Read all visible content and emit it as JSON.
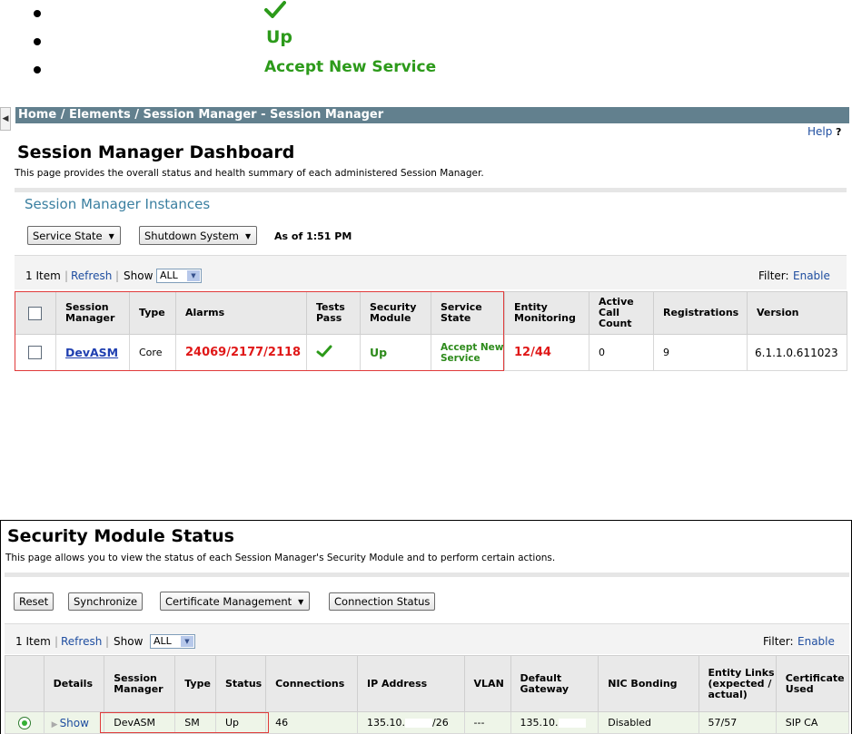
{
  "legend": {
    "items": [
      {
        "icon": "checkmark-icon",
        "text": ""
      },
      {
        "icon": "",
        "text": "Up"
      },
      {
        "icon": "",
        "text": "Accept New Service"
      }
    ]
  },
  "dashboard": {
    "breadcrumb": "Home / Elements / Session Manager - Session Manager",
    "help_label": "Help",
    "help_mark": "?",
    "title": "Session Manager Dashboard",
    "description": "This page provides the overall status and health summary of each administered Session Manager.",
    "section_title": "Session Manager Instances",
    "service_state_button": "Service State",
    "shutdown_button": "Shutdown System",
    "as_of": "As of 1:51 PM",
    "toolbar": {
      "item_count": "1 Item",
      "separator": "|",
      "refresh": "Refresh",
      "show_label": "Show",
      "show_value": "ALL",
      "filter_label": "Filter:",
      "filter_link": "Enable"
    },
    "columns": [
      "",
      "Session Manager",
      "Type",
      "Alarms",
      "Tests Pass",
      "Security Module",
      "Service State",
      "Entity Monitoring",
      "Active Call Count",
      "Registrations",
      "Version"
    ],
    "row": {
      "session_manager": "DevASM",
      "type": "Core",
      "alarms": "24069/2177/2118",
      "tests_pass_icon": "checkmark-icon",
      "security_module": "Up",
      "service_state": "Accept New Service",
      "entity_monitoring": "12/44",
      "active_call_count": "0",
      "registrations": "9",
      "version": "6.1.1.0.611023"
    },
    "colors": {
      "accent": "#3a7fa0",
      "breadcrumb_bg": "#62808e",
      "alarm": "#e01818",
      "ok": "#2c8a1a",
      "highlight": "#e03a3a"
    }
  },
  "security": {
    "title": "Security Module Status",
    "description": "This page allows you to view the status of each Session Manager's Security Module and to perform certain actions.",
    "buttons": {
      "reset": "Reset",
      "synchronize": "Synchronize",
      "certificate_management": "Certificate Management",
      "connection_status": "Connection Status"
    },
    "toolbar": {
      "item_count": "1 Item",
      "separator": "|",
      "refresh": "Refresh",
      "show_label": "Show",
      "show_value": "ALL",
      "filter_label": "Filter:",
      "filter_link": "Enable"
    },
    "columns": [
      "",
      "Details",
      "Session Manager",
      "Type",
      "Status",
      "Connections",
      "IP Address",
      "VLAN",
      "Default Gateway",
      "NIC Bonding",
      "Entity Links (expected / actual)",
      "Certificate Used"
    ],
    "row": {
      "details": "Show",
      "session_manager": "DevASM",
      "type": "SM",
      "status": "Up",
      "connections": "46",
      "ip_prefix": "135.10.",
      "ip_suffix": "/26",
      "vlan": "---",
      "gateway_prefix": "135.10.",
      "nic_bonding": "Disabled",
      "entity_links": "57/57",
      "certificate": "SIP CA"
    }
  }
}
